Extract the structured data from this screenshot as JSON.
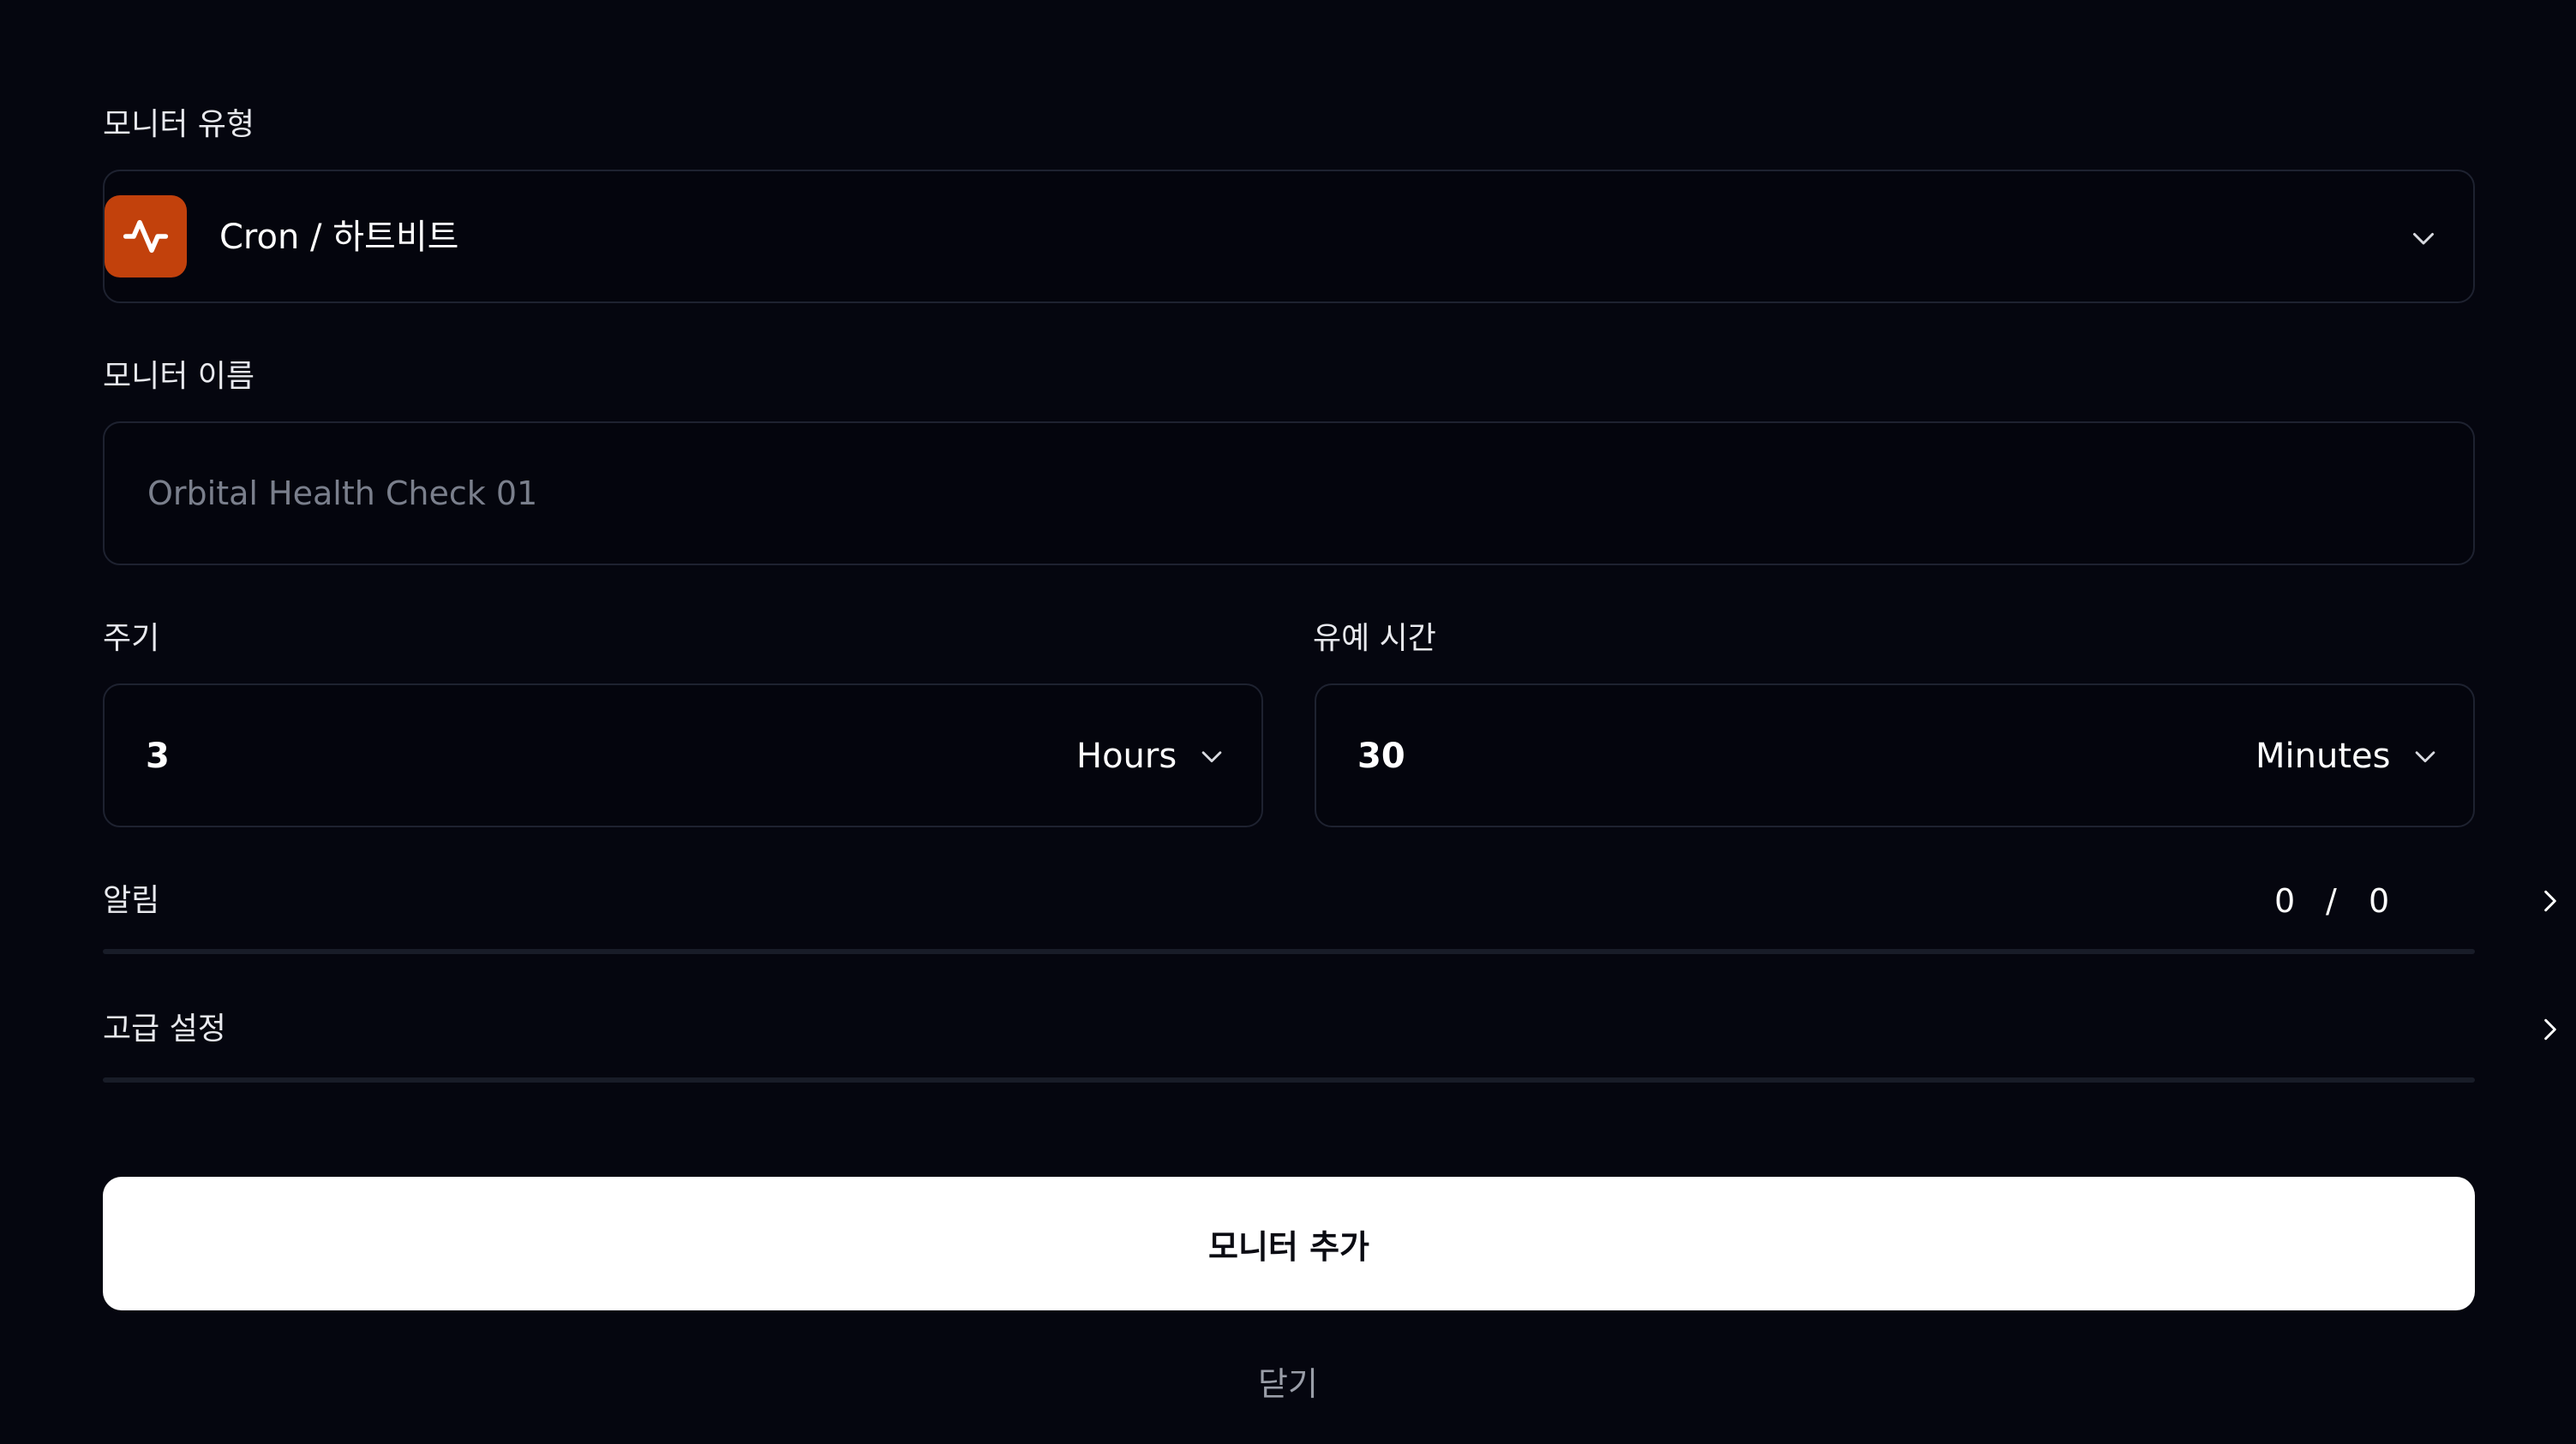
{
  "monitor_type": {
    "label": "모니터 유형",
    "selected": "Cron / 하트비트",
    "icon": "activity-pulse-icon",
    "icon_color": "#c2410c"
  },
  "monitor_name": {
    "label": "모니터 이름",
    "placeholder": "Orbital Health Check 01"
  },
  "period": {
    "label": "주기",
    "value": "3",
    "unit": "Hours"
  },
  "grace": {
    "label": "유예 시간",
    "value": "30",
    "unit": "Minutes"
  },
  "alerts": {
    "label": "알림",
    "count_current": "0",
    "separator": "/",
    "count_total": "0"
  },
  "advanced": {
    "label": "고급 설정"
  },
  "actions": {
    "submit_label": "모니터 추가",
    "close_label": "닫기"
  }
}
